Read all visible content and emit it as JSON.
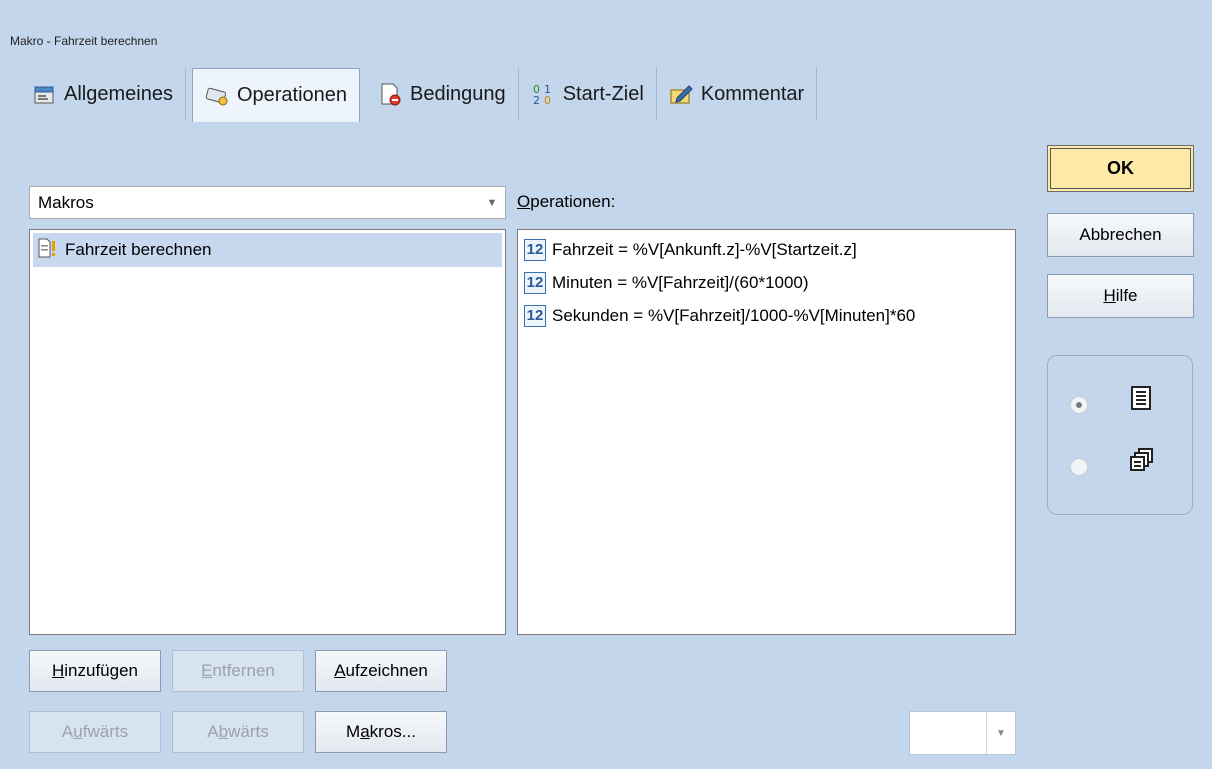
{
  "window": {
    "title": "Makro - Fahrzeit berechnen"
  },
  "tabs": [
    {
      "label": "Allgemeines",
      "icon": "properties-icon"
    },
    {
      "label": "Operationen",
      "icon": "keyboard-hand-icon",
      "active": true
    },
    {
      "label": "Bedingung",
      "icon": "document-stop-icon"
    },
    {
      "label": "Start-Ziel",
      "icon": "start-goal-icon"
    },
    {
      "label": "Kommentar",
      "icon": "pencil-note-icon"
    }
  ],
  "macro_select": {
    "value": "Makros"
  },
  "macro_list": {
    "items": [
      "Fahrzeit berechnen"
    ]
  },
  "operations": {
    "label_u": "O",
    "label_rest": "perationen:",
    "badge": "12",
    "items": [
      "Fahrzeit = %V[Ankunft.z]-%V[Startzeit.z]",
      "Minuten = %V[Fahrzeit]/(60*1000)",
      "Sekunden = %V[Fahrzeit]/1000-%V[Minuten]*60"
    ]
  },
  "buttons": {
    "ok": "OK",
    "cancel": "Abbrechen",
    "help_u": "H",
    "help_rest": "ilfe",
    "add_u": "H",
    "add_rest": "inzufügen",
    "remove_u": "E",
    "remove_rest": "ntfernen",
    "record_u": "A",
    "record_rest": "ufzeichnen",
    "up_pre": "A",
    "up_u": "u",
    "up_rest": "fwärts",
    "down_pre": "A",
    "down_u": "b",
    "down_rest": "wärts",
    "macros_pre": "M",
    "macros_u": "a",
    "macros_rest": "kros..."
  },
  "view_mode": {
    "options": [
      "list-view",
      "cascade-view"
    ],
    "selected": 0
  },
  "colors": {
    "background": "#c3d6ec",
    "ok_button": "#fde9a8",
    "selection": "#c8d8ef"
  }
}
